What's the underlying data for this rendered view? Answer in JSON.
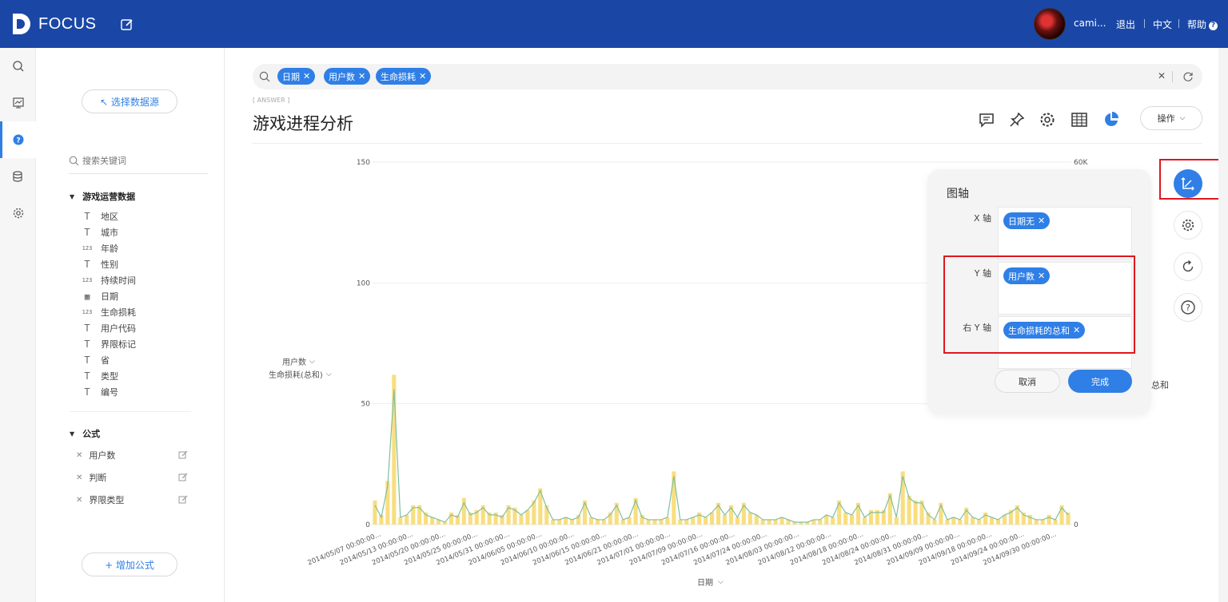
{
  "header": {
    "logo_text": "FOCUS",
    "user": "cami...",
    "logout": "退出",
    "language": "中文",
    "help": "帮助"
  },
  "rail": [
    "search-icon",
    "board-icon",
    "question-icon",
    "database-icon",
    "gear-icon"
  ],
  "datapanel": {
    "select_source": "↖ 选择数据源",
    "search_placeholder": "搜索关键词",
    "group_name": "游戏运营数据",
    "fields": [
      {
        "type": "T",
        "name": "地区"
      },
      {
        "type": "T",
        "name": "城市"
      },
      {
        "type": "123",
        "name": "年龄"
      },
      {
        "type": "T",
        "name": "性别"
      },
      {
        "type": "123",
        "name": "持续时间"
      },
      {
        "type": "date",
        "name": "日期"
      },
      {
        "type": "123",
        "name": "生命损耗"
      },
      {
        "type": "T",
        "name": "用户代码"
      },
      {
        "type": "T",
        "name": "界限标记"
      },
      {
        "type": "T",
        "name": "省"
      },
      {
        "type": "T",
        "name": "类型"
      },
      {
        "type": "T",
        "name": "编号"
      }
    ],
    "formula_group": "公式",
    "formulas": [
      "用户数",
      "判断",
      "界限类型"
    ],
    "add_formula": "+ 增加公式"
  },
  "query": {
    "tags": [
      "日期",
      "用户数",
      "生命损耗"
    ]
  },
  "answer_label": "[ ANSWER ]",
  "title": "游戏进程分析",
  "operation_label": "操作",
  "axis_popup": {
    "title": "图轴",
    "x_label": "X 轴",
    "x_tag": "日期无",
    "y_label": "Y 轴",
    "y_tag": "用户数",
    "ry_label": "右 Y 轴",
    "ry_tag": "生命损耗的总和",
    "cancel": "取消",
    "done": "完成"
  },
  "behind_text": "总和",
  "colors": {
    "brand": "#1a47a6",
    "accent": "#2f7fe6",
    "bar": "#f9de7f",
    "line": "#7fbf9f",
    "highlight": "#e0161e"
  },
  "chart_data": {
    "type": "bar",
    "xlabel": "日期",
    "y_left_label_1": "用户数",
    "y_left_label_2": "生命损耗(总和)",
    "ylim_left": [
      0,
      150
    ],
    "yticks_left": [
      "150",
      "100",
      "50",
      "0"
    ],
    "ytick_values_left": [
      150,
      100,
      50,
      0
    ],
    "yticks_right": [
      "60K",
      "0"
    ],
    "x_tick_labels": [
      "2014/05/07 00:00:00...",
      "2014/05/13 00:00:00...",
      "2014/05/20 00:00:00...",
      "2014/05/25 00:00:00...",
      "2014/05/31 00:00:00...",
      "2014/06/05 00:00:00...",
      "2014/06/10 00:00:00...",
      "2014/06/15 00:00:00...",
      "2014/06/21 00:00:00...",
      "2014/07/01 00:00:00...",
      "2014/07/09 00:00:00...",
      "2014/07/16 00:00:00...",
      "2014/07/24 00:00:00...",
      "2014/08/03 00:00:00...",
      "2014/08/12 00:00:00...",
      "2014/08/18 00:00:00...",
      "2014/08/24 00:00:00...",
      "2014/08/31 00:00:00...",
      "2014/09/09 00:00:00...",
      "2014/09/18 00:00:00...",
      "2014/09/24 00:00:00...",
      "2014/09/30 00:00:00..."
    ],
    "series": [
      {
        "name": "生命损耗(总和)",
        "values": [
          10,
          4,
          18,
          62,
          3,
          4,
          8,
          8,
          5,
          3,
          2,
          1,
          5,
          4,
          11,
          5,
          6,
          8,
          5,
          5,
          4,
          8,
          7,
          4,
          6,
          10,
          15,
          8,
          2,
          2,
          3,
          2,
          4,
          10,
          3,
          2,
          2,
          5,
          9,
          2,
          3,
          11,
          4,
          2,
          2,
          2,
          3,
          22,
          2,
          2,
          3,
          5,
          3,
          5,
          9,
          4,
          8,
          3,
          9,
          5,
          4,
          2,
          2,
          2,
          3,
          2,
          1,
          1,
          1,
          2,
          2,
          4,
          3,
          10,
          5,
          4,
          9,
          3,
          6,
          6,
          6,
          13,
          3,
          22,
          12,
          10,
          10,
          5,
          2,
          9,
          2,
          3,
          2,
          7,
          3,
          2,
          5,
          3,
          2,
          4,
          6,
          8,
          5,
          4,
          2,
          2,
          4,
          2,
          8,
          5
        ]
      },
      {
        "name": "用户数",
        "values": [
          8,
          3,
          16,
          56,
          3,
          4,
          7,
          7,
          4,
          3,
          2,
          1,
          4,
          3,
          9,
          4,
          5,
          7,
          4,
          4,
          3,
          7,
          6,
          4,
          6,
          9,
          14,
          7,
          2,
          2,
          3,
          2,
          3,
          9,
          3,
          2,
          2,
          4,
          8,
          2,
          3,
          10,
          3,
          2,
          2,
          2,
          3,
          20,
          2,
          2,
          3,
          4,
          3,
          5,
          8,
          4,
          7,
          3,
          8,
          5,
          4,
          2,
          2,
          2,
          3,
          2,
          1,
          1,
          1,
          2,
          2,
          4,
          3,
          9,
          5,
          4,
          8,
          3,
          5,
          5,
          5,
          12,
          3,
          20,
          11,
          9,
          9,
          4,
          2,
          8,
          2,
          3,
          2,
          6,
          3,
          2,
          4,
          3,
          2,
          4,
          5,
          7,
          4,
          3,
          2,
          2,
          3,
          2,
          7,
          4
        ]
      }
    ]
  }
}
